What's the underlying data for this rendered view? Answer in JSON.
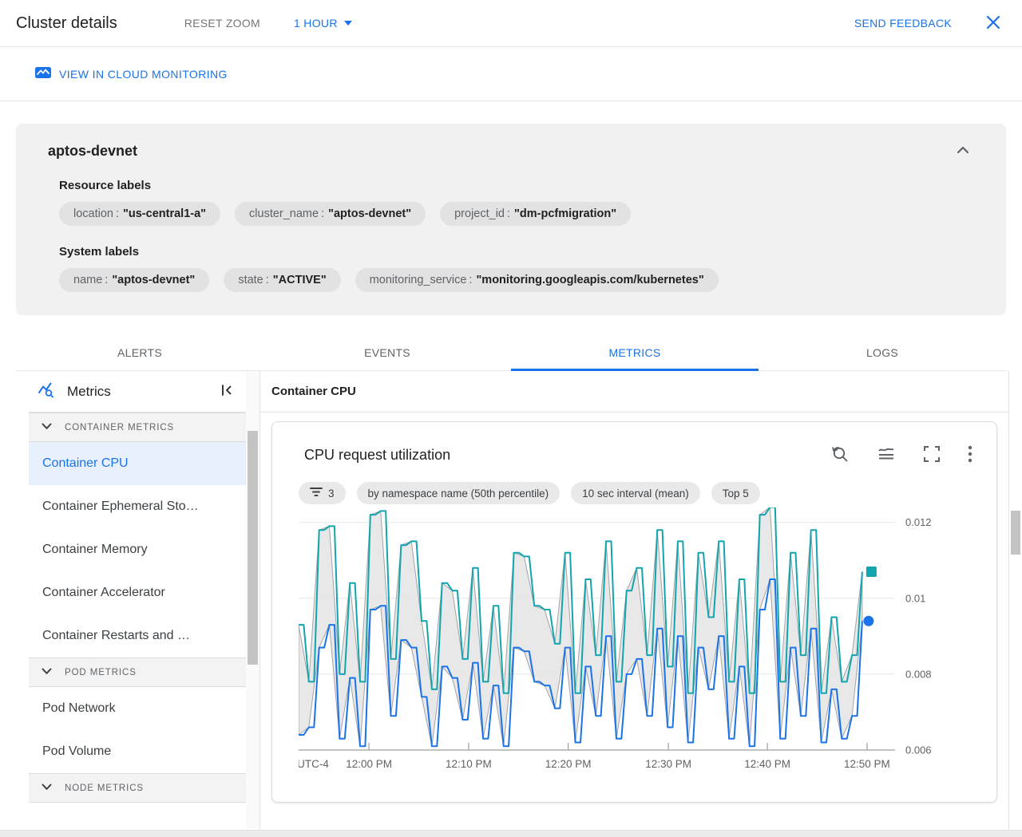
{
  "header": {
    "title": "Cluster details",
    "reset_zoom": "RESET ZOOM",
    "time_range": "1 HOUR",
    "send_feedback": "SEND FEEDBACK"
  },
  "monitor_bar": {
    "link_label": "VIEW IN CLOUD MONITORING"
  },
  "cluster_card": {
    "name": "aptos-devnet",
    "resource_labels_title": "Resource labels",
    "resource_labels": [
      {
        "key": "location",
        "value": "\"us-central1-a\""
      },
      {
        "key": "cluster_name",
        "value": "\"aptos-devnet\""
      },
      {
        "key": "project_id",
        "value": "\"dm-pcfmigration\""
      }
    ],
    "system_labels_title": "System labels",
    "system_labels": [
      {
        "key": "name",
        "value": "\"aptos-devnet\""
      },
      {
        "key": "state",
        "value": "\"ACTIVE\""
      },
      {
        "key": "monitoring_service",
        "value": "\"monitoring.googleapis.com/kubernetes\""
      }
    ]
  },
  "tabs": [
    {
      "label": "ALERTS",
      "active": false
    },
    {
      "label": "EVENTS",
      "active": false
    },
    {
      "label": "METRICS",
      "active": true
    },
    {
      "label": "LOGS",
      "active": false
    }
  ],
  "sidebar": {
    "title": "Metrics",
    "sections": [
      {
        "label": "CONTAINER METRICS",
        "items": [
          {
            "label": "Container CPU",
            "selected": true
          },
          {
            "label": "Container Ephemeral Sto…",
            "selected": false
          },
          {
            "label": "Container Memory",
            "selected": false
          },
          {
            "label": "Container Accelerator",
            "selected": false
          },
          {
            "label": "Container Restarts and …",
            "selected": false
          }
        ]
      },
      {
        "label": "POD METRICS",
        "items": [
          {
            "label": "Pod Network",
            "selected": false
          },
          {
            "label": "Pod Volume",
            "selected": false
          }
        ]
      },
      {
        "label": "NODE METRICS",
        "items": []
      }
    ]
  },
  "main": {
    "panel_title": "Container CPU",
    "chart_title": "CPU request utilization",
    "chips": [
      {
        "icon": "filter",
        "label": "3"
      },
      {
        "icon": "",
        "label": "by namespace name (50th percentile)"
      },
      {
        "icon": "",
        "label": "10 sec interval (mean)"
      },
      {
        "icon": "",
        "label": "Top 5"
      }
    ]
  },
  "chart_data": {
    "type": "line",
    "title": "CPU request utilization",
    "x_axis": {
      "timezone_label": "UTC-4",
      "tick_labels": [
        "12:00 PM",
        "12:10 PM",
        "12:20 PM",
        "12:30 PM",
        "12:40 PM",
        "12:50 PM"
      ],
      "tick_fractions": [
        0.118,
        0.285,
        0.452,
        0.62,
        0.786,
        0.953
      ],
      "range_minutes": 60
    },
    "y_axis": {
      "tick_values": [
        0.006,
        0.008,
        0.01,
        0.012
      ],
      "tick_labels": [
        "0.006",
        "0.008",
        "0.01",
        "0.012"
      ],
      "range": [
        0.006,
        0.01235
      ]
    },
    "x_end_fraction": 0.945,
    "grid": true,
    "band": {
      "fill": "#e5e5e5",
      "stroke": "#a3a3a3"
    },
    "series": [
      {
        "color": "#12a4af",
        "marker": "square",
        "values": [
          0.0093,
          0.0078,
          0.0118,
          0.0119,
          0.008,
          0.0104,
          0.0078,
          0.0122,
          0.0123,
          0.0084,
          0.0114,
          0.0115,
          0.0094,
          0.0076,
          0.0104,
          0.0102,
          0.0084,
          0.0108,
          0.0078,
          0.0098,
          0.0075,
          0.0112,
          0.0111,
          0.0098,
          0.0097,
          0.0088,
          0.0112,
          0.0075,
          0.0105,
          0.0085,
          0.0115,
          0.0078,
          0.0102,
          0.0108,
          0.0085,
          0.0118,
          0.0082,
          0.0115,
          0.0075,
          0.0112,
          0.0095,
          0.0115,
          0.0078,
          0.0105,
          0.0075,
          0.0122,
          0.0124,
          0.0078,
          0.0112,
          0.0085,
          0.0118,
          0.0075,
          0.0095,
          0.0078,
          0.0085,
          0.0107
        ]
      },
      {
        "color": "#1a73e8",
        "marker": "circle",
        "values": [
          0.0064,
          0.0066,
          0.0087,
          0.0093,
          0.0063,
          0.0079,
          0.0061,
          0.0097,
          0.0098,
          0.0069,
          0.0089,
          0.0087,
          0.0074,
          0.0061,
          0.0082,
          0.0079,
          0.0068,
          0.0083,
          0.0063,
          0.0077,
          0.0061,
          0.0087,
          0.0086,
          0.0078,
          0.0077,
          0.0071,
          0.0087,
          0.0062,
          0.0082,
          0.0069,
          0.009,
          0.0063,
          0.008,
          0.0084,
          0.0069,
          0.0092,
          0.0066,
          0.009,
          0.0062,
          0.0087,
          0.0076,
          0.009,
          0.0063,
          0.0082,
          0.0061,
          0.0097,
          0.0105,
          0.0063,
          0.0087,
          0.0069,
          0.0092,
          0.0062,
          0.0076,
          0.0063,
          0.0069,
          0.0094
        ]
      }
    ]
  }
}
